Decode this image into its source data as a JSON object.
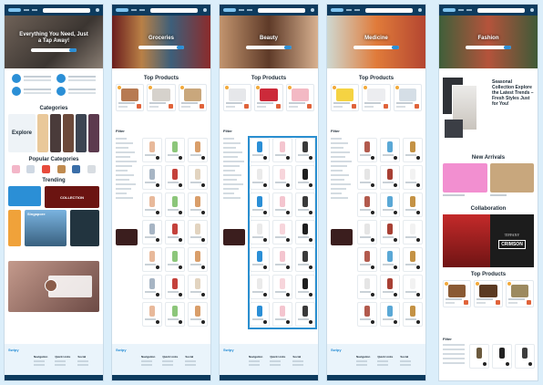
{
  "colors": {
    "accent": "#2b8fd6",
    "nav": "#0d3b5e",
    "orange": "#e0633a",
    "frame": "#dbeefa"
  },
  "panel1": {
    "hero_title": "Everything You Need, Just a Tap Away!",
    "categories_title": "Categories",
    "explore_label": "Explore",
    "popular_title": "Popular Categories",
    "trending_title": "Trending",
    "trend_tile_label": "COLLECTION",
    "city_label": "Singapore",
    "footer_logo": "Swipy",
    "footer_cols": [
      "Navigation",
      "Quick Links",
      "Social"
    ]
  },
  "panel2": {
    "hero_title": "Groceries",
    "top_products": "Top Products",
    "filters": "Filter",
    "footer_logo": "Swipy",
    "footer_cols": [
      "Navigation",
      "Quick Links",
      "Social"
    ]
  },
  "panel3": {
    "hero_title": "Beauty",
    "top_products": "Top Products",
    "filters": "Filter",
    "footer_logo": "Swipy",
    "footer_cols": [
      "Navigation",
      "Quick Links",
      "Social"
    ]
  },
  "panel4": {
    "hero_title": "Medicine",
    "top_products": "Top Products",
    "filters": "Filter",
    "footer_logo": "Swipy",
    "footer_cols": [
      "Navigation",
      "Quick Links",
      "Social"
    ]
  },
  "panel5": {
    "hero_title": "Fashion",
    "seasonal_text": "Seasonal Collection Explore the Latest Trends – Fresh Styles Just for You!",
    "new_arrivals": "New Arrivals",
    "collaboration": "Collaboration",
    "collab_brand": "TIFFANY",
    "collab_title": "CRIMSON",
    "top_products": "Top Products",
    "filters": "Filter"
  }
}
